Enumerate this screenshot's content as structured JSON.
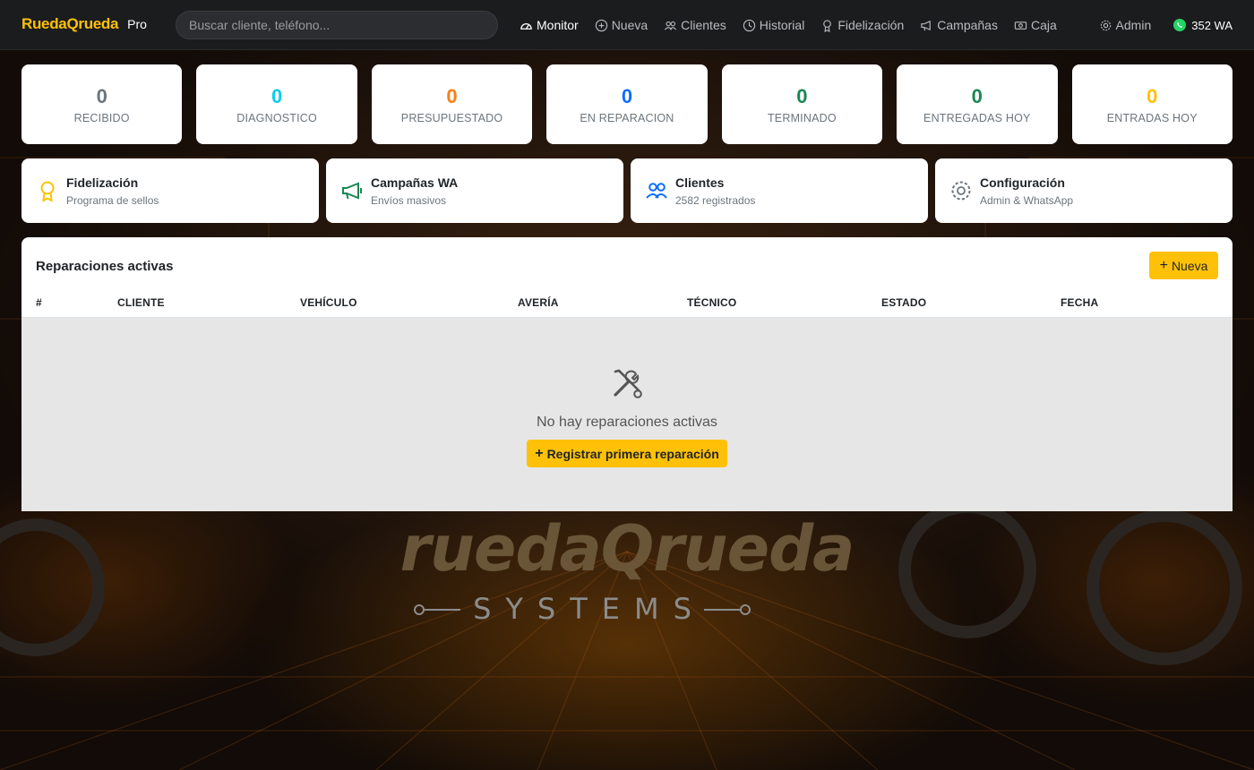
{
  "navbar": {
    "brand": "RuedaQrueda",
    "brand_suffix": "Pro",
    "search_placeholder": "Buscar cliente, teléfono...",
    "links": [
      {
        "label": "Monitor",
        "icon": "speedometer-icon",
        "active": true
      },
      {
        "label": "Nueva",
        "icon": "plus-circle-icon"
      },
      {
        "label": "Clientes",
        "icon": "people-icon"
      },
      {
        "label": "Historial",
        "icon": "clock-icon"
      },
      {
        "label": "Fidelización",
        "icon": "award-icon"
      },
      {
        "label": "Campañas",
        "icon": "megaphone-icon"
      },
      {
        "label": "Caja",
        "icon": "cash-icon"
      }
    ],
    "admin_label": "Admin",
    "wa_label": "352 WA"
  },
  "stats": [
    {
      "value": "0",
      "label": "RECIBIDO",
      "color": "#6c757d"
    },
    {
      "value": "0",
      "label": "DIAGNOSTICO",
      "color": "#0dcaf0"
    },
    {
      "value": "0",
      "label": "PRESUPUESTADO",
      "color": "#fd7e14"
    },
    {
      "value": "0",
      "label": "EN REPARACION",
      "color": "#0d6efd"
    },
    {
      "value": "0",
      "label": "TERMINADO",
      "color": "#198754"
    },
    {
      "value": "0",
      "label": "ENTREGADAS HOY",
      "color": "#198754"
    },
    {
      "value": "0",
      "label": "ENTRADAS HOY",
      "color": "#ffc107"
    }
  ],
  "quick_cards": [
    {
      "title": "Fidelización",
      "subtitle": "Programa de sellos",
      "icon": "award-icon",
      "color": "#ffc107"
    },
    {
      "title": "Campañas WA",
      "subtitle": "Envíos masivos",
      "icon": "megaphone-icon",
      "color": "#198754"
    },
    {
      "title": "Clientes",
      "subtitle": "2582 registrados",
      "icon": "people-icon",
      "color": "#0d6efd"
    },
    {
      "title": "Configuración",
      "subtitle": "Admin & WhatsApp",
      "icon": "gear-icon",
      "color": "#6c757d"
    }
  ],
  "repairs": {
    "title": "Reparaciones activas",
    "new_button": "Nueva",
    "columns": [
      "#",
      "CLIENTE",
      "VEHÍCULO",
      "AVERÍA",
      "TÉCNICO",
      "ESTADO",
      "FECHA"
    ],
    "empty_text": "No hay reparaciones activas",
    "empty_icon": "tools-icon",
    "empty_button": "Registrar primera reparación"
  },
  "background": {
    "logo_text": "ruedaQrueda",
    "logo_sub": "SYSTEMS"
  },
  "colors": {
    "accent": "#ffc107",
    "navbar_bg": "#1b1c1e"
  }
}
